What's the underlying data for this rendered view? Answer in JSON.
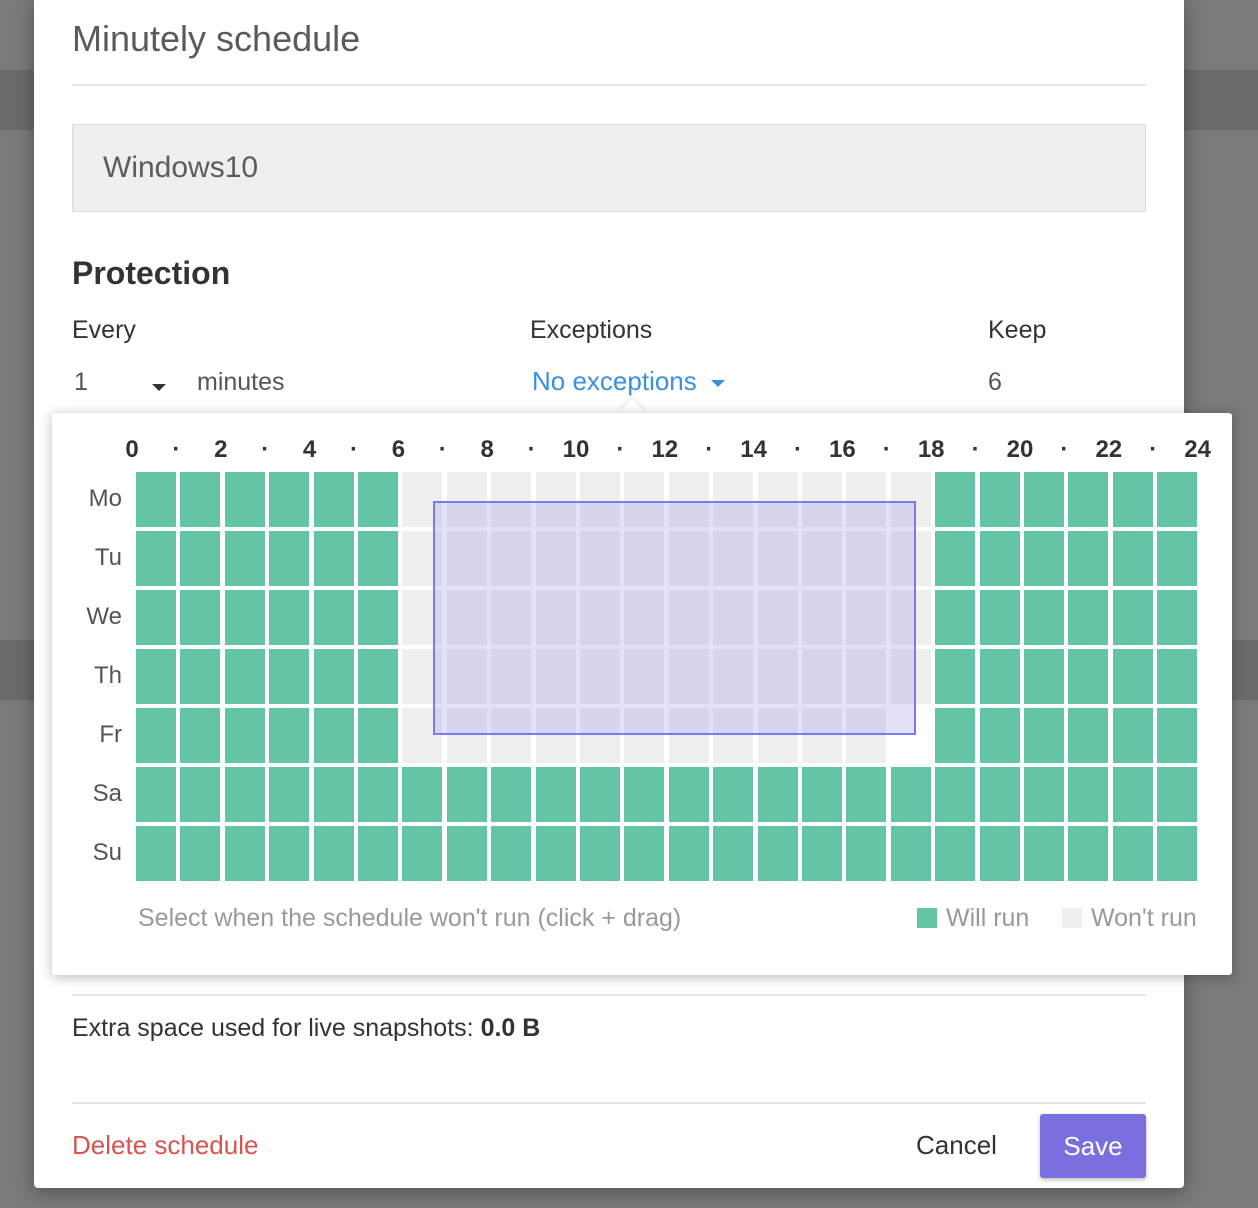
{
  "dialog": {
    "title": "Minutely schedule",
    "name_value": "Windows10",
    "section_title": "Protection",
    "every_label": "Every",
    "every_value": "1",
    "every_unit": "minutes",
    "exceptions_label": "Exceptions",
    "exceptions_value": "No exceptions",
    "keep_label": "Keep",
    "keep_value": "6",
    "extra_space_label": "Extra space used for live snapshots:",
    "extra_space_value": "0.0 B",
    "delete_label": "Delete schedule",
    "cancel_label": "Cancel",
    "save_label": "Save"
  },
  "schedule": {
    "hour_labels": [
      "0",
      "2",
      "4",
      "6",
      "8",
      "10",
      "12",
      "14",
      "16",
      "18",
      "20",
      "22",
      "24"
    ],
    "separator": "·",
    "days": [
      "Mo",
      "Tu",
      "We",
      "Th",
      "Fr",
      "Sa",
      "Su"
    ],
    "off_ranges": [
      {
        "day": "Mo",
        "from": 6,
        "to": 18
      },
      {
        "day": "Tu",
        "from": 6,
        "to": 18
      },
      {
        "day": "We",
        "from": 6,
        "to": 18
      },
      {
        "day": "Th",
        "from": 6,
        "to": 18
      },
      {
        "day": "Fr",
        "from": 6,
        "to": 17
      }
    ],
    "blank_cells": [
      {
        "day": "Fr",
        "hour": 17
      }
    ],
    "selection": {
      "from_day": "Mo",
      "to_day": "Fr",
      "from_hour": 7,
      "to_hour": 17
    },
    "hint": "Select when the schedule won't run (click + drag)",
    "legend_will_run": "Will run",
    "legend_wont_run": "Won't run"
  },
  "colors": {
    "will_run": "#63c5a5",
    "wont_run": "#efefef",
    "accent": "#7b6fe0",
    "link": "#3b8fe0",
    "danger": "#d9534f"
  }
}
